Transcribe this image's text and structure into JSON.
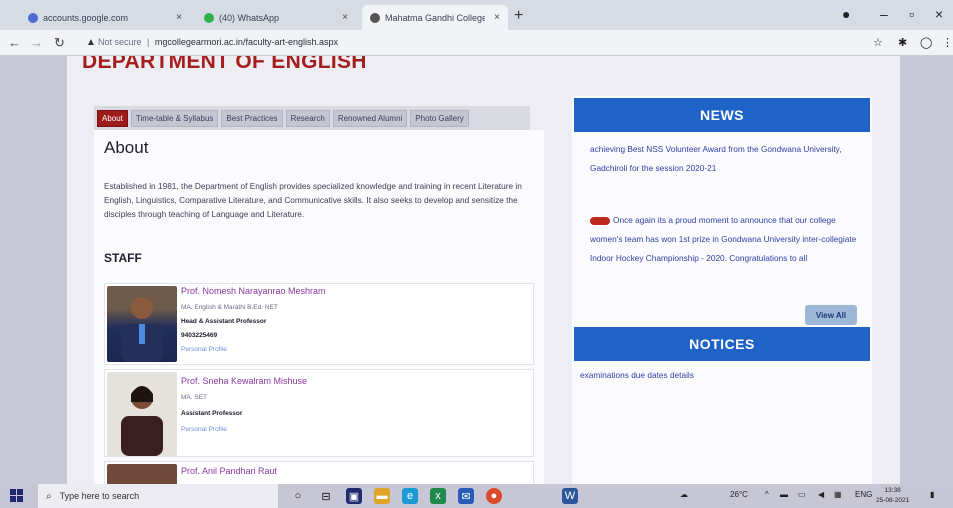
{
  "browser": {
    "tabs": [
      {
        "title": "accounts.google.com",
        "active": false
      },
      {
        "title": "(40) WhatsApp",
        "active": false
      },
      {
        "title": "Mahatma Gandhi College Armor",
        "active": true
      }
    ],
    "url_prefix": "Not secure",
    "url_host": "mgcollegearmori.ac.in/faculty-art-english.aspx"
  },
  "page": {
    "heading": "DEPARTMENT OF ENGLISH",
    "tabs": [
      "About",
      "Time-table & Syllabus",
      "Best Practices",
      "Research",
      "Renowned Alumni",
      "Photo Gallery"
    ],
    "about_title": "About",
    "about_text": "Established in 1981, the Department of English provides specialized knowledge and training in recent Literature in English, Linguistics, Comparative Literature, and Communicative skills. It also seeks to develop and sensitize the disciples through teaching of Language and Literature.",
    "staff_title": "STAFF",
    "staff": [
      {
        "name": "Prof. Nomesh Narayanrao Meshram",
        "qual": "MA. English & Marathi B.Ed. NET",
        "designation": "Head & Assistant Professor",
        "phone": "9403225469",
        "link": "Personal Profile"
      },
      {
        "name": "Prof. Sneha Kewalram Mishuse",
        "qual": "MA. SET",
        "designation": "Assistant Professor",
        "link": "Personal Profile"
      },
      {
        "name": "Prof. Anil Pandhari Raut"
      }
    ]
  },
  "news": {
    "title": "NEWS",
    "item1": "achieving Best NSS Volunteer Award from the Gondwana University, Gadchiroli for the session 2020-21",
    "item2": "Once again its a proud moment to announce that our college women's team has won 1st prize in Gondwana University inter-collegiate Indoor Hockey Championship - 2020. Congratulations to all",
    "view_all": "View All"
  },
  "notices": {
    "title": "NOTICES",
    "item1": "examinations due dates details"
  },
  "taskbar": {
    "search_placeholder": "Type here to search",
    "temperature": "26°C",
    "language": "ENG",
    "time": "13:38",
    "date": "25-08-2021"
  }
}
